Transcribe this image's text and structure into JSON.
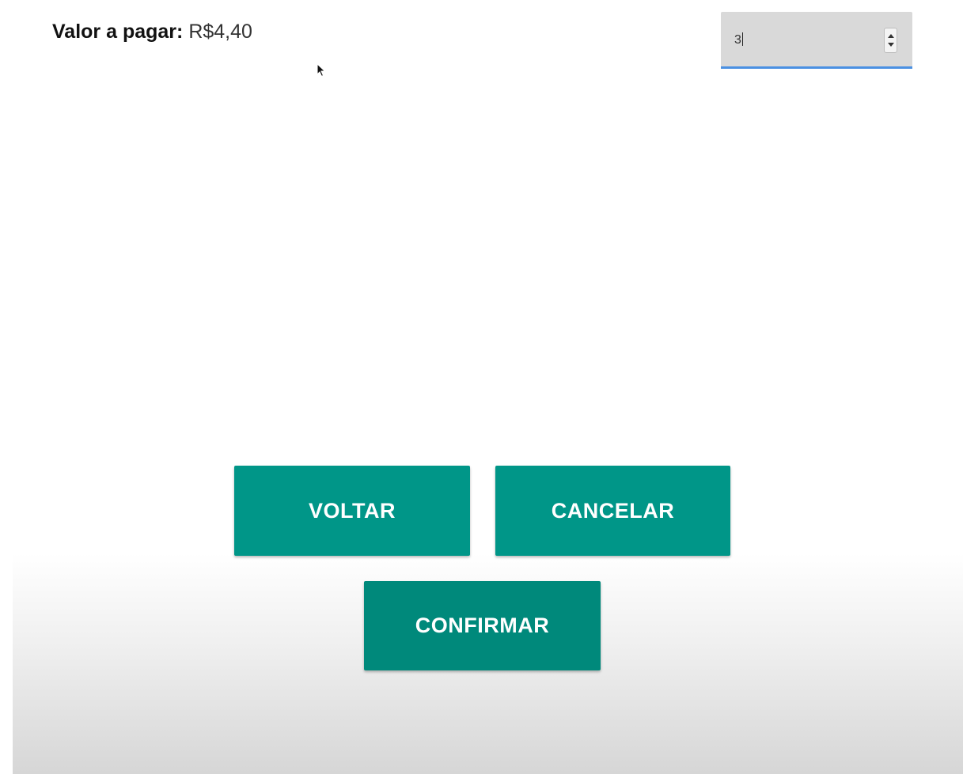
{
  "payment": {
    "label": "Valor a pagar:",
    "value": "R$4,40"
  },
  "quantity_input": {
    "value": "3"
  },
  "buttons": {
    "back": "VOLTAR",
    "cancel": "CANCELAR",
    "confirm": "CONFIRMAR"
  },
  "colors": {
    "button": "#009688",
    "input_underline": "#4a90e2",
    "input_background": "#d9d9d9"
  }
}
